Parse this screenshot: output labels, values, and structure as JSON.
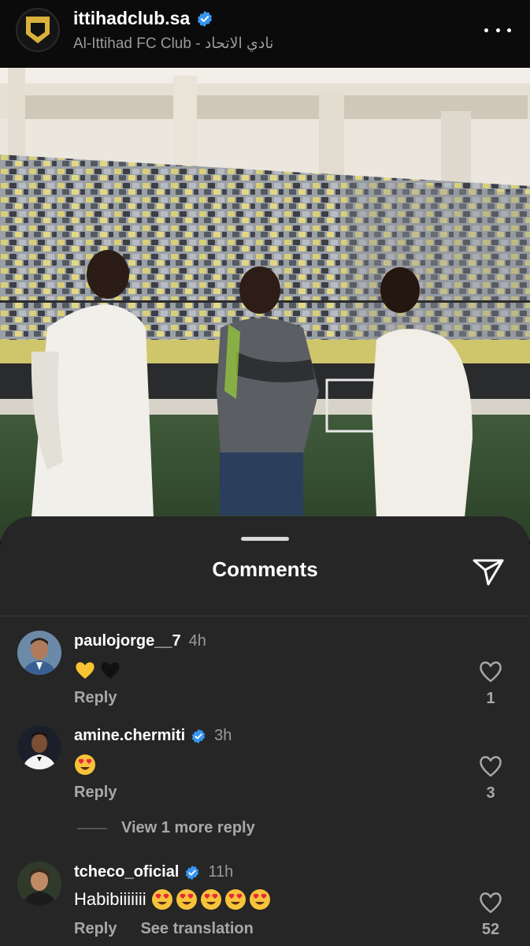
{
  "header": {
    "account": "ittihadclub.sa",
    "subtitle": "Al-Ittihad FC Club - نادي الاتحاد"
  },
  "sheet": {
    "title": "Comments"
  },
  "comments": [
    {
      "username": "paulojorge__7",
      "verified": false,
      "time": "4h",
      "text": "",
      "emojis": [
        "yellow-heart",
        "black-heart"
      ],
      "reply_label": "Reply",
      "likes": "1"
    },
    {
      "username": "amine.chermiti",
      "verified": true,
      "time": "3h",
      "text": "",
      "emojis": [
        "heart-eyes"
      ],
      "reply_label": "Reply",
      "likes": "3",
      "more_replies": "View 1 more reply"
    },
    {
      "username": "tcheco_oficial",
      "verified": true,
      "time": "11h",
      "text": "Habibiiiiiii",
      "emojis": [
        "heart-eyes",
        "heart-eyes",
        "heart-eyes",
        "heart-eyes",
        "heart-eyes"
      ],
      "reply_label": "Reply",
      "translation_label": "See translation",
      "likes": "52"
    }
  ],
  "colors": {
    "verified": "#3797f0",
    "sheet_bg": "#262626",
    "muted_text": "#a8a8a8",
    "club_gold": "#d9b13b"
  }
}
